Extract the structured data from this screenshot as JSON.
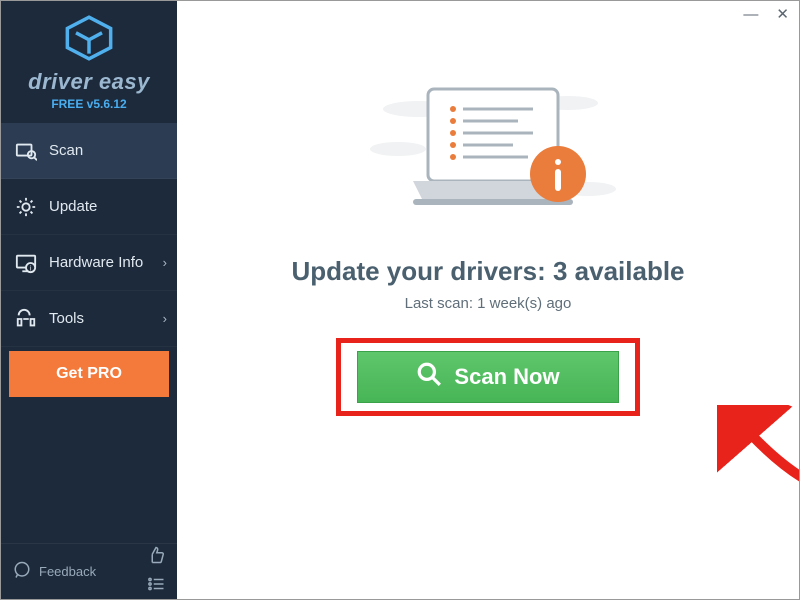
{
  "brand": {
    "name": "driver easy",
    "version": "FREE v5.6.12"
  },
  "nav": {
    "scan": "Scan",
    "update": "Update",
    "hardware": "Hardware Info",
    "tools": "Tools"
  },
  "get_pro": "Get PRO",
  "feedback": "Feedback",
  "main": {
    "headline": "Update your drivers: 3 available",
    "last_scan": "Last scan: 1 week(s) ago",
    "scan_button": "Scan Now"
  }
}
